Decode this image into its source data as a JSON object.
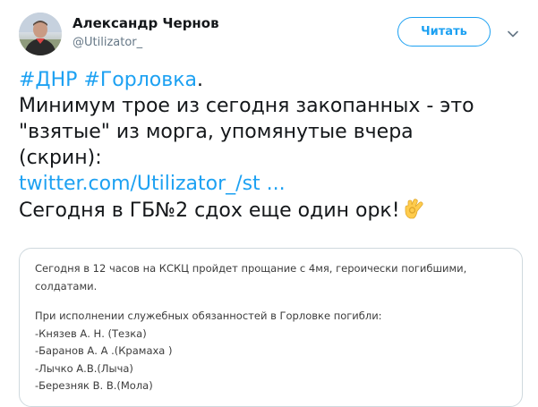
{
  "author": {
    "name": "Александр Чернов",
    "handle": "@Utilizator_"
  },
  "follow_button": {
    "label": "Читать"
  },
  "tweet": {
    "hashtag1": "#ДНР",
    "hashtag2": "#Горловка",
    "period": ".",
    "line2": "Минимум трое из сегодня закопанных - это",
    "line3": "\"взятые\" из морга, упомянутые вчера",
    "line4": "(скрин):",
    "link": "twitter.com/Utilizator_/st ...",
    "line6": "Сегодня в ГБ№2 сдох еще один орк!",
    "emoji": "ok-hand-emoji"
  },
  "quoted_card": {
    "line1": "Сегодня в 12 часов на КСКЦ пройдет прощание с 4мя, героически погибшими,",
    "line2": "солдатами.",
    "line3": "При исполнении служебных обязанностей в Горловке погибли:",
    "names": [
      "-Князев А. Н. (Тезка)",
      "-Баранов А. А .(Крамаха )",
      "-Лычко А.В.(Лыча)",
      "-Березняк В. В.(Мола)"
    ]
  },
  "colors": {
    "accent": "#1da1f2",
    "text": "#14171a",
    "muted": "#657786",
    "card_border": "#cfd9de"
  },
  "icons": {
    "menu": "chevron-down-icon"
  }
}
